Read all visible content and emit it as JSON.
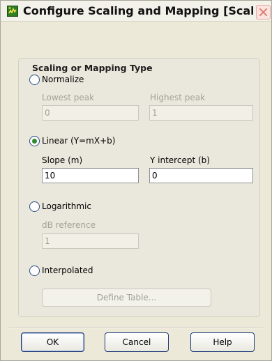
{
  "window": {
    "title": "Configure Scaling and Mapping [Scalin..."
  },
  "group": {
    "title": "Scaling or Mapping Type"
  },
  "options": {
    "normalize": {
      "label": "Normalize",
      "checked": false,
      "lowest_peak": {
        "label": "Lowest peak",
        "value": "0"
      },
      "highest_peak": {
        "label": "Highest peak",
        "value": "1"
      }
    },
    "linear": {
      "label": "Linear (Y=mX+b)",
      "checked": true,
      "slope": {
        "label": "Slope (m)",
        "value": "10"
      },
      "intercept": {
        "label": "Y intercept (b)",
        "value": "0"
      }
    },
    "logarithmic": {
      "label": "Logarithmic",
      "checked": false,
      "db_reference": {
        "label": "dB reference",
        "value": "1"
      }
    },
    "interpolated": {
      "label": "Interpolated",
      "checked": false,
      "define_table_label": "Define Table..."
    }
  },
  "buttons": {
    "ok": "OK",
    "cancel": "Cancel",
    "help": "Help"
  }
}
